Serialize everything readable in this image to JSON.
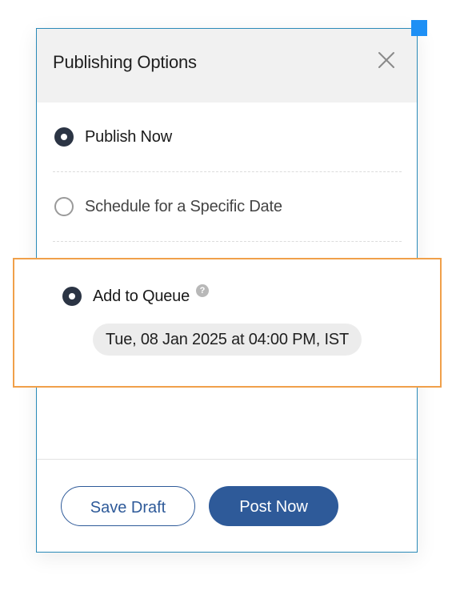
{
  "dialog": {
    "title": "Publishing Options",
    "close_icon": "close-icon"
  },
  "options": [
    {
      "label": "Publish Now",
      "checked": true
    },
    {
      "label": "Schedule for a Specific Date",
      "checked": false
    },
    {
      "label": "Add to Queue",
      "checked": true,
      "help_icon": "question-circle-icon",
      "help_glyph": "?"
    }
  ],
  "queue": {
    "datetime": "Tue, 08 Jan 2025 at 04:00 PM, IST"
  },
  "footer": {
    "save_draft_label": "Save Draft",
    "post_now_label": "Post Now"
  },
  "colors": {
    "accent": "#2e5a99",
    "highlight_border": "#f0a04a",
    "panel_border": "#2a8ab8",
    "selection_handle": "#1e90f5",
    "radio_checked": "#2b3444"
  }
}
